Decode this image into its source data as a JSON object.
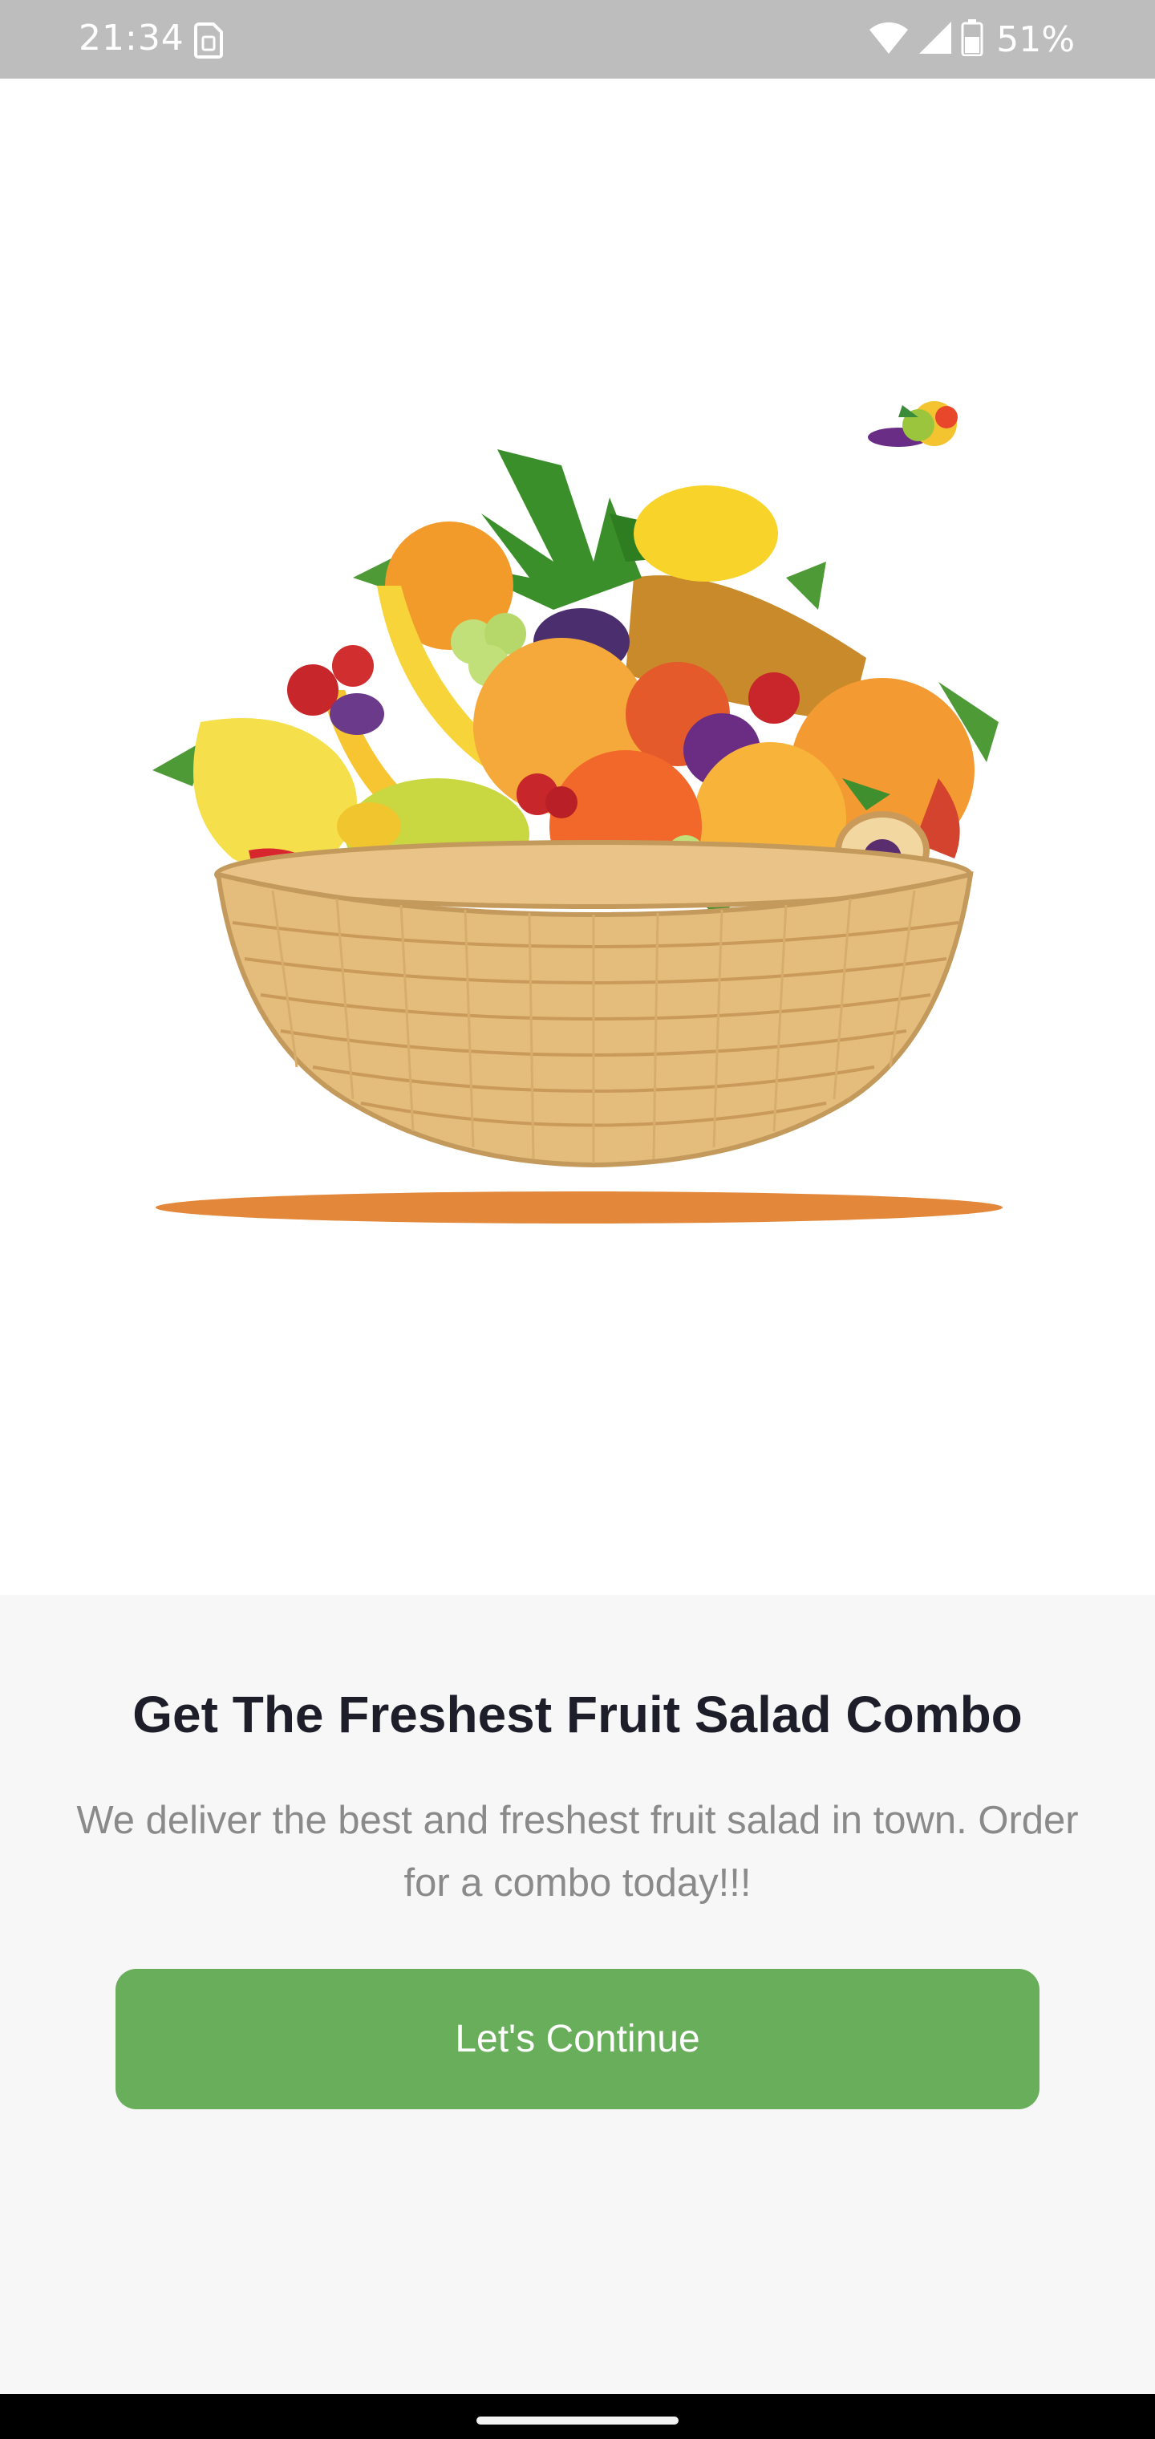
{
  "status_bar": {
    "time": "21:34",
    "battery_percent": "51%",
    "icons": [
      "sim-icon",
      "wifi-icon",
      "signal-icon",
      "battery-icon"
    ]
  },
  "hero": {
    "image": "fruit-basket-illustration",
    "small_image": "fruit-cluster-illustration"
  },
  "onboarding": {
    "title": "Get The Freshest Fruit Salad Combo",
    "description": "We deliver the best and freshest fruit salad in town. Order for a combo today!!!",
    "continue_label": "Let's Continue"
  },
  "colors": {
    "accent": "#69ae5b",
    "status_bar": "#bdbdbd",
    "panel_bg": "#f7f7f7",
    "shadow": "#e3873a"
  }
}
